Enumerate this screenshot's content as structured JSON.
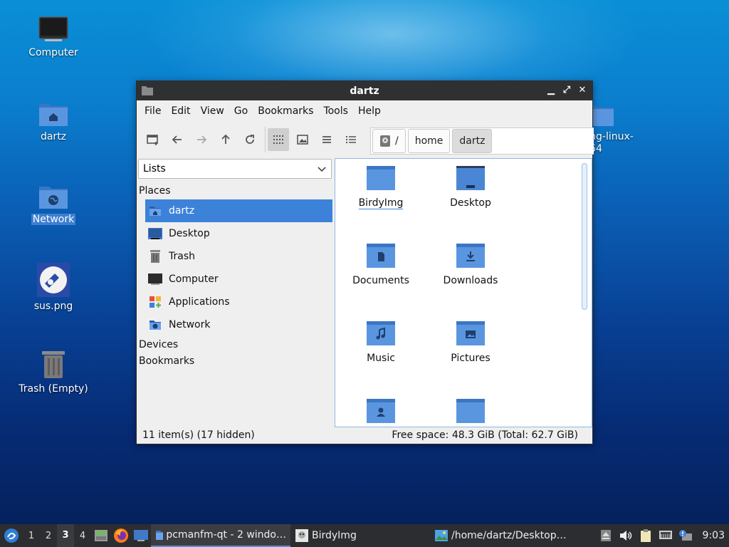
{
  "desktop": {
    "icons": [
      {
        "label": "Computer"
      },
      {
        "label": "dartz"
      },
      {
        "label": "Network"
      },
      {
        "label": "sus.png"
      },
      {
        "label": "Trash (Empty)"
      },
      {
        "label": "ng-linux-\n64"
      }
    ]
  },
  "window": {
    "title": "dartz",
    "menu": [
      "File",
      "Edit",
      "View",
      "Go",
      "Bookmarks",
      "Tools",
      "Help"
    ],
    "pathbar": {
      "root": "/",
      "crumbs": [
        "home",
        "dartz"
      ]
    },
    "side": {
      "mode": "Lists",
      "sections": {
        "places": "Places",
        "devices": "Devices",
        "bookmarks": "Bookmarks"
      },
      "places": [
        {
          "label": "dartz",
          "icon": "home-folder-icon"
        },
        {
          "label": "Desktop",
          "icon": "desktop-icon"
        },
        {
          "label": "Trash",
          "icon": "trash-icon"
        },
        {
          "label": "Computer",
          "icon": "computer-icon"
        },
        {
          "label": "Applications",
          "icon": "applications-icon"
        },
        {
          "label": "Network",
          "icon": "network-icon"
        }
      ]
    },
    "files": [
      {
        "name": "BirdyImg",
        "icon": "folder-icon"
      },
      {
        "name": "Desktop",
        "icon": "desktop-folder-icon"
      },
      {
        "name": "Documents",
        "icon": "documents-folder-icon"
      },
      {
        "name": "Downloads",
        "icon": "downloads-folder-icon"
      },
      {
        "name": "Music",
        "icon": "music-folder-icon"
      },
      {
        "name": "Pictures",
        "icon": "pictures-folder-icon"
      },
      {
        "name": "",
        "icon": "public-folder-icon"
      },
      {
        "name": "",
        "icon": "folder-icon"
      }
    ],
    "status": {
      "items": "11 item(s) (17 hidden)",
      "space": "Free space: 48.3 GiB (Total: 62.7 GiB)"
    }
  },
  "taskbar": {
    "workspaces": [
      "1",
      "2",
      "3",
      "4"
    ],
    "current_workspace": "3",
    "tasks": [
      {
        "label": "pcmanfm-qt - 2 windo…"
      },
      {
        "label": "BirdyImg"
      },
      {
        "label": "/home/dartz/Desktop…"
      }
    ],
    "clock": "9:03"
  },
  "colors": {
    "accent": "#3d82d9",
    "folder": "#4a86d4",
    "titlebar": "#2f3032"
  }
}
